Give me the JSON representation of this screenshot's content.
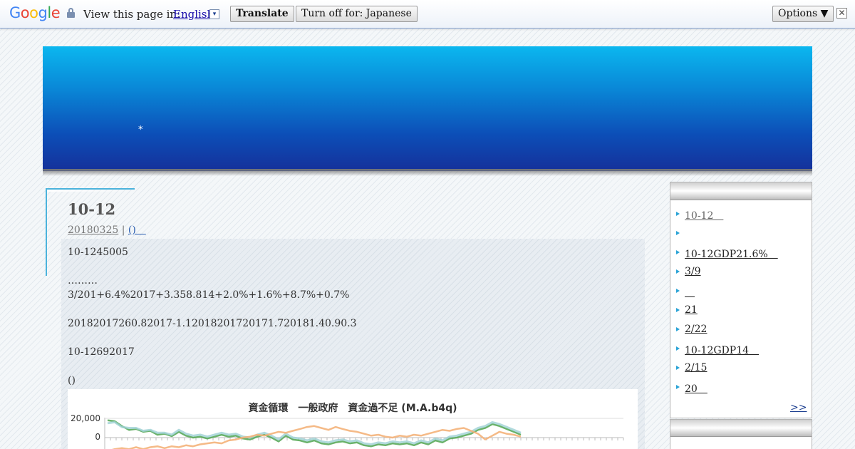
{
  "translate_bar": {
    "logo": [
      "G",
      "o",
      "o",
      "g",
      "l",
      "e"
    ],
    "view_label": "View this page in:",
    "language": "English",
    "translate_button": "Translate",
    "turn_off_button": "Turn off for: Japanese",
    "options_button": "Options ▼",
    "close_glyph": "✕"
  },
  "header": {
    "star": "*"
  },
  "post": {
    "title": "10-12",
    "date": "20180325",
    "separator": "|",
    "category": "()　",
    "paragraphs": [
      "10-1245005",
      "………",
      "3/201+6.4%2017+3.358.814+2.0%+1.6%+8.7%+0.7%",
      "20182017260.82017-1.12018201720171.720181.40.90.3",
      "10-12692017",
      "()"
    ]
  },
  "chart": {
    "title": "資金循環　一般政府　資金過不足 (M.A.b4q)",
    "y_ticks": [
      "20,000",
      "0"
    ],
    "colors": {
      "green": "#5aaa5a",
      "teal": "#9ed1d4",
      "orange": "#f4b27a"
    }
  },
  "chart_data": {
    "type": "line",
    "title": "資金循環　一般政府　資金過不足 (M.A.b4q)",
    "ylim": [
      -10000,
      20000
    ],
    "y_ticks": [
      20000,
      0
    ],
    "series": [
      {
        "values": [
          18000,
          17000,
          12000,
          8000,
          9000,
          6000,
          7000,
          3000,
          4000,
          1500,
          6000,
          2000,
          0,
          1000,
          -1000,
          1000,
          3000,
          1000,
          2000,
          -1000,
          -2000,
          1000,
          3000,
          0,
          -4000,
          2000,
          -2000,
          -3000,
          -5000,
          -3000,
          -6000,
          -7000,
          -5000,
          -4000,
          -6000,
          -5000,
          -8000,
          -9000,
          -7000,
          -8000,
          -6000,
          -7000,
          -6000,
          -8000,
          -5000,
          -7000,
          -3000,
          -5000,
          -1000,
          0,
          2000,
          4000,
          8000,
          10000,
          14000,
          12000,
          9000,
          6000,
          3000
        ]
      },
      {
        "values": [
          15000,
          16000,
          11000,
          10000,
          10000,
          7000,
          8000,
          5000,
          5000,
          3000,
          8000,
          4000,
          2000,
          3000,
          1000,
          3000,
          5000,
          3000,
          4000,
          1000,
          0,
          3000,
          5000,
          2000,
          -2000,
          4000,
          0,
          -1000,
          -3000,
          -1000,
          -4000,
          -5000,
          -3000,
          -2000,
          -4000,
          -3000,
          -6000,
          -7000,
          -5000,
          -6000,
          -4000,
          -5000,
          -4000,
          -6000,
          -3000,
          -5000,
          -1000,
          -3000,
          1000,
          2000,
          4000,
          6000,
          10000,
          12000,
          16000,
          14000,
          11000,
          8000,
          5000
        ]
      },
      {
        "values": [
          -14000,
          -12000,
          -11000,
          -12000,
          -10000,
          -12000,
          -10000,
          -9000,
          -11000,
          -9000,
          -10000,
          -8000,
          -9000,
          -7000,
          -6000,
          -5000,
          -6000,
          -3000,
          -2000,
          0,
          1000,
          3000,
          2000,
          4000,
          6000,
          5000,
          7000,
          9000,
          11000,
          12000,
          10000,
          8000,
          11000,
          9000,
          7000,
          6000,
          4000,
          2000,
          3000,
          1000,
          0,
          2000,
          1000,
          3000,
          2000,
          4000,
          6000,
          8000,
          7000,
          9000,
          10000,
          7000,
          4000,
          -2000,
          2000,
          6000,
          4000,
          3000,
          1000
        ]
      }
    ]
  },
  "sidebar": {
    "items": [
      "10-12　",
      "",
      "10-12GDP21.6%　",
      "3/9",
      "　",
      "21",
      "2/22",
      "10-12GDP14　",
      "2/15",
      "20　"
    ],
    "more": ">>",
    "second_text": ""
  }
}
